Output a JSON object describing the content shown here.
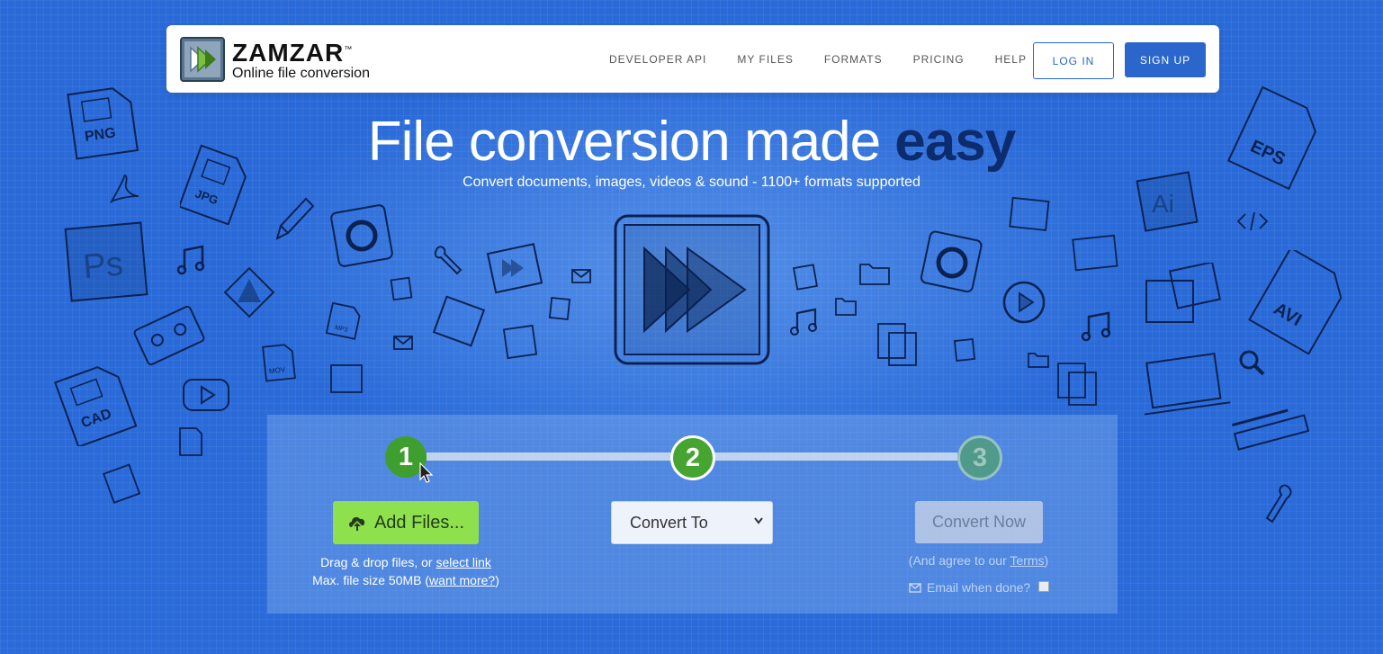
{
  "brand": {
    "name": "ZAMZAR",
    "trademark": "™",
    "tagline": "Online file conversion"
  },
  "nav": {
    "links": [
      "DEVELOPER API",
      "MY FILES",
      "FORMATS",
      "PRICING",
      "HELP"
    ],
    "login": "LOG IN",
    "signup": "SIGN UP"
  },
  "hero": {
    "title_plain": "File conversion made ",
    "title_bold": "easy",
    "subtitle": "Convert documents, images, videos & sound - 1100+ formats supported"
  },
  "converter": {
    "steps": [
      "1",
      "2",
      "3"
    ],
    "add_files_label": "Add Files...",
    "drag_text": "Drag & drop files, or ",
    "select_link": "select link",
    "max_size_text": "Max. file size 50MB (",
    "want_more_link": "want more?",
    "max_size_close": ")",
    "convert_to_label": "Convert To",
    "convert_now_label": "Convert Now",
    "agree_open": "(And agree to our ",
    "terms_link": "Terms",
    "agree_close": ")",
    "email_label": "Email when done?"
  },
  "doodle_labels": {
    "png": "PNG",
    "jpg": "JPG",
    "ps": "Ps",
    "cad": "CAD",
    "mov": "MOV",
    "mp3": "MP3",
    "eps": "EPS",
    "ai": "Ai",
    "avi": "AVI"
  },
  "colors": {
    "background": "#2a6ad8",
    "brand_blue": "#2a66cc",
    "add_files_green": "#8ee14d",
    "step_green": "#46a531",
    "title_dark": "#0d2c6e"
  }
}
